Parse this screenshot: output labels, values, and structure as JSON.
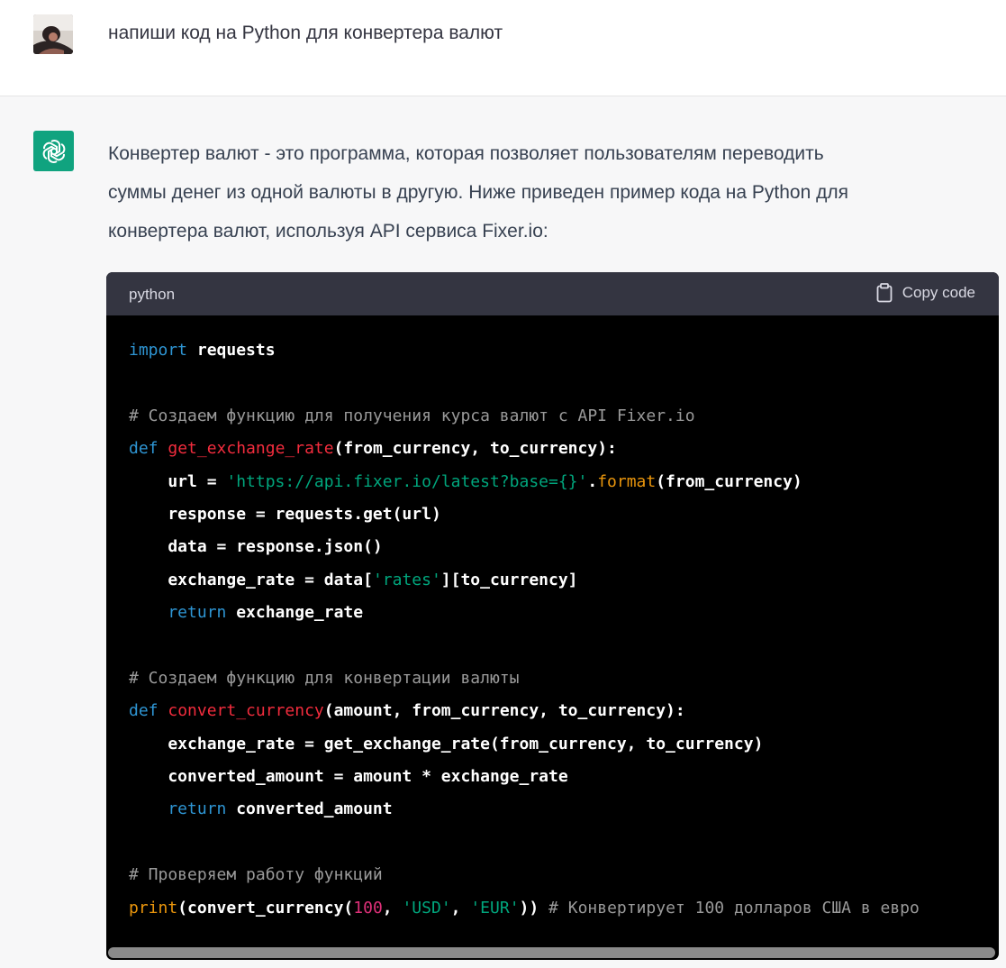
{
  "user_message": {
    "text": "напиши код на Python для конвертера валют"
  },
  "assistant_message": {
    "lines": [
      "Конвертер валют - это программа, которая позволяет пользователям переводить",
      "суммы денег из одной валюты в другую. Ниже приведен пример кода на Python для",
      "конвертера валют, используя API сервиса Fixer.io:"
    ]
  },
  "code_block": {
    "language": "python",
    "copy_label": "Copy code",
    "lines": [
      [
        [
          "kw",
          "import"
        ],
        [
          "id",
          " requests"
        ]
      ],
      [],
      [
        [
          "cm",
          "# Создаем функцию для получения курса валют с API Fixer.io"
        ]
      ],
      [
        [
          "kw",
          "def"
        ],
        [
          "id",
          " "
        ],
        [
          "fn",
          "get_exchange_rate"
        ],
        [
          "id",
          "(from_currency, to_currency):"
        ]
      ],
      [
        [
          "id",
          "    url = "
        ],
        [
          "str",
          "'https://api.fixer.io/latest?base={}'"
        ],
        [
          "id",
          "."
        ],
        [
          "bi",
          "format"
        ],
        [
          "id",
          "(from_currency)"
        ]
      ],
      [
        [
          "id",
          "    response = requests.get(url)"
        ]
      ],
      [
        [
          "id",
          "    data = response.json()"
        ]
      ],
      [
        [
          "id",
          "    exchange_rate = data["
        ],
        [
          "str",
          "'rates'"
        ],
        [
          "id",
          "][to_currency]"
        ]
      ],
      [
        [
          "kw",
          "    return"
        ],
        [
          "id",
          " exchange_rate"
        ]
      ],
      [],
      [
        [
          "cm",
          "# Создаем функцию для конвертации валюты"
        ]
      ],
      [
        [
          "kw",
          "def"
        ],
        [
          "id",
          " "
        ],
        [
          "fn",
          "convert_currency"
        ],
        [
          "id",
          "(amount, from_currency, to_currency):"
        ]
      ],
      [
        [
          "id",
          "    exchange_rate = get_exchange_rate(from_currency, to_currency)"
        ]
      ],
      [
        [
          "id",
          "    converted_amount = amount * exchange_rate"
        ]
      ],
      [
        [
          "kw",
          "    return"
        ],
        [
          "id",
          " converted_amount"
        ]
      ],
      [],
      [
        [
          "cm",
          "# Проверяем работу функций"
        ]
      ],
      [
        [
          "bi",
          "print"
        ],
        [
          "id",
          "(convert_currency("
        ],
        [
          "num",
          "100"
        ],
        [
          "id",
          ", "
        ],
        [
          "str",
          "'USD'"
        ],
        [
          "id",
          ", "
        ],
        [
          "str",
          "'EUR'"
        ],
        [
          "id",
          "))"
        ],
        [
          "cm",
          " # Конвертирует 100 долларов США в евро"
        ]
      ]
    ]
  },
  "colors": {
    "bot_avatar": "#10a37f",
    "code_bg": "#000000",
    "code_header_bg": "#343541"
  }
}
